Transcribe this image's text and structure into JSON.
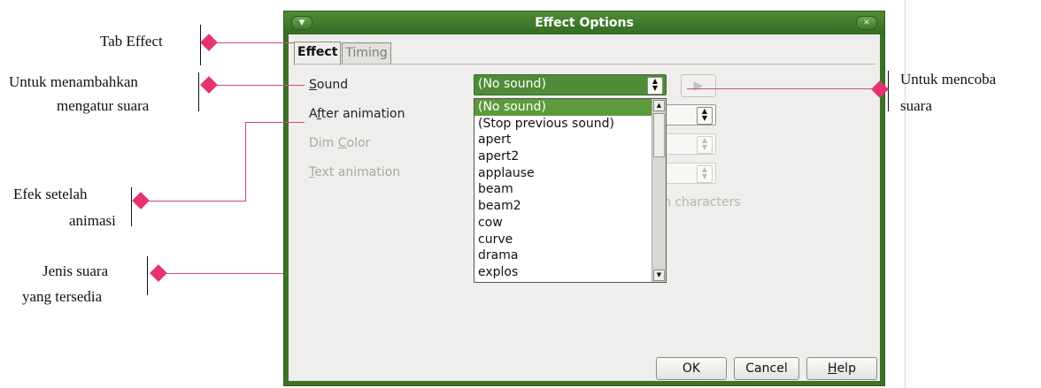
{
  "dialog": {
    "title": "Effect Options",
    "menu_icon": "chevron-down-icon",
    "close_icon": "close-icon",
    "tabs": [
      {
        "label": "Effect",
        "active": true
      },
      {
        "label": "Timing",
        "active": false
      }
    ],
    "fields": {
      "sound": {
        "label_first": "S",
        "label_rest": "ound",
        "value": "(No sound)"
      },
      "after_animation": {
        "label_first": "A",
        "label_mid": "f",
        "label_rest": "ter animation"
      },
      "dim_color": {
        "label_pre": "Dim ",
        "label_under": "C",
        "label_rest": "olor"
      },
      "text_animation": {
        "label_under": "T",
        "label_rest": "ext animation"
      },
      "delay_between_characters_partial": "n characters"
    },
    "sound_options": [
      "(No sound)",
      "(Stop previous sound)",
      "apert",
      "apert2",
      "applause",
      "beam",
      "beam2",
      "cow",
      "curve",
      "drama",
      "explos"
    ],
    "selected_sound_index": 0,
    "buttons": {
      "ok": "OK",
      "cancel": "Cancel",
      "help_under": "H",
      "help_rest": "elp"
    },
    "colors": {
      "titlebar": "#3f7a2b",
      "selection": "#5c9a3c",
      "marker": "#e6336d"
    }
  },
  "annotations": {
    "tab_effect": "Tab Effect",
    "add_sound_line1": "Untuk menambahkan",
    "add_sound_line2": "mengatur suara",
    "after_anim_line1": "Efek setelah",
    "after_anim_line2": "animasi",
    "sound_types_line1": "Jenis suara",
    "sound_types_line2": "yang tersedia",
    "test_sound_line1": "Untuk mencoba",
    "test_sound_line2": "suara"
  }
}
